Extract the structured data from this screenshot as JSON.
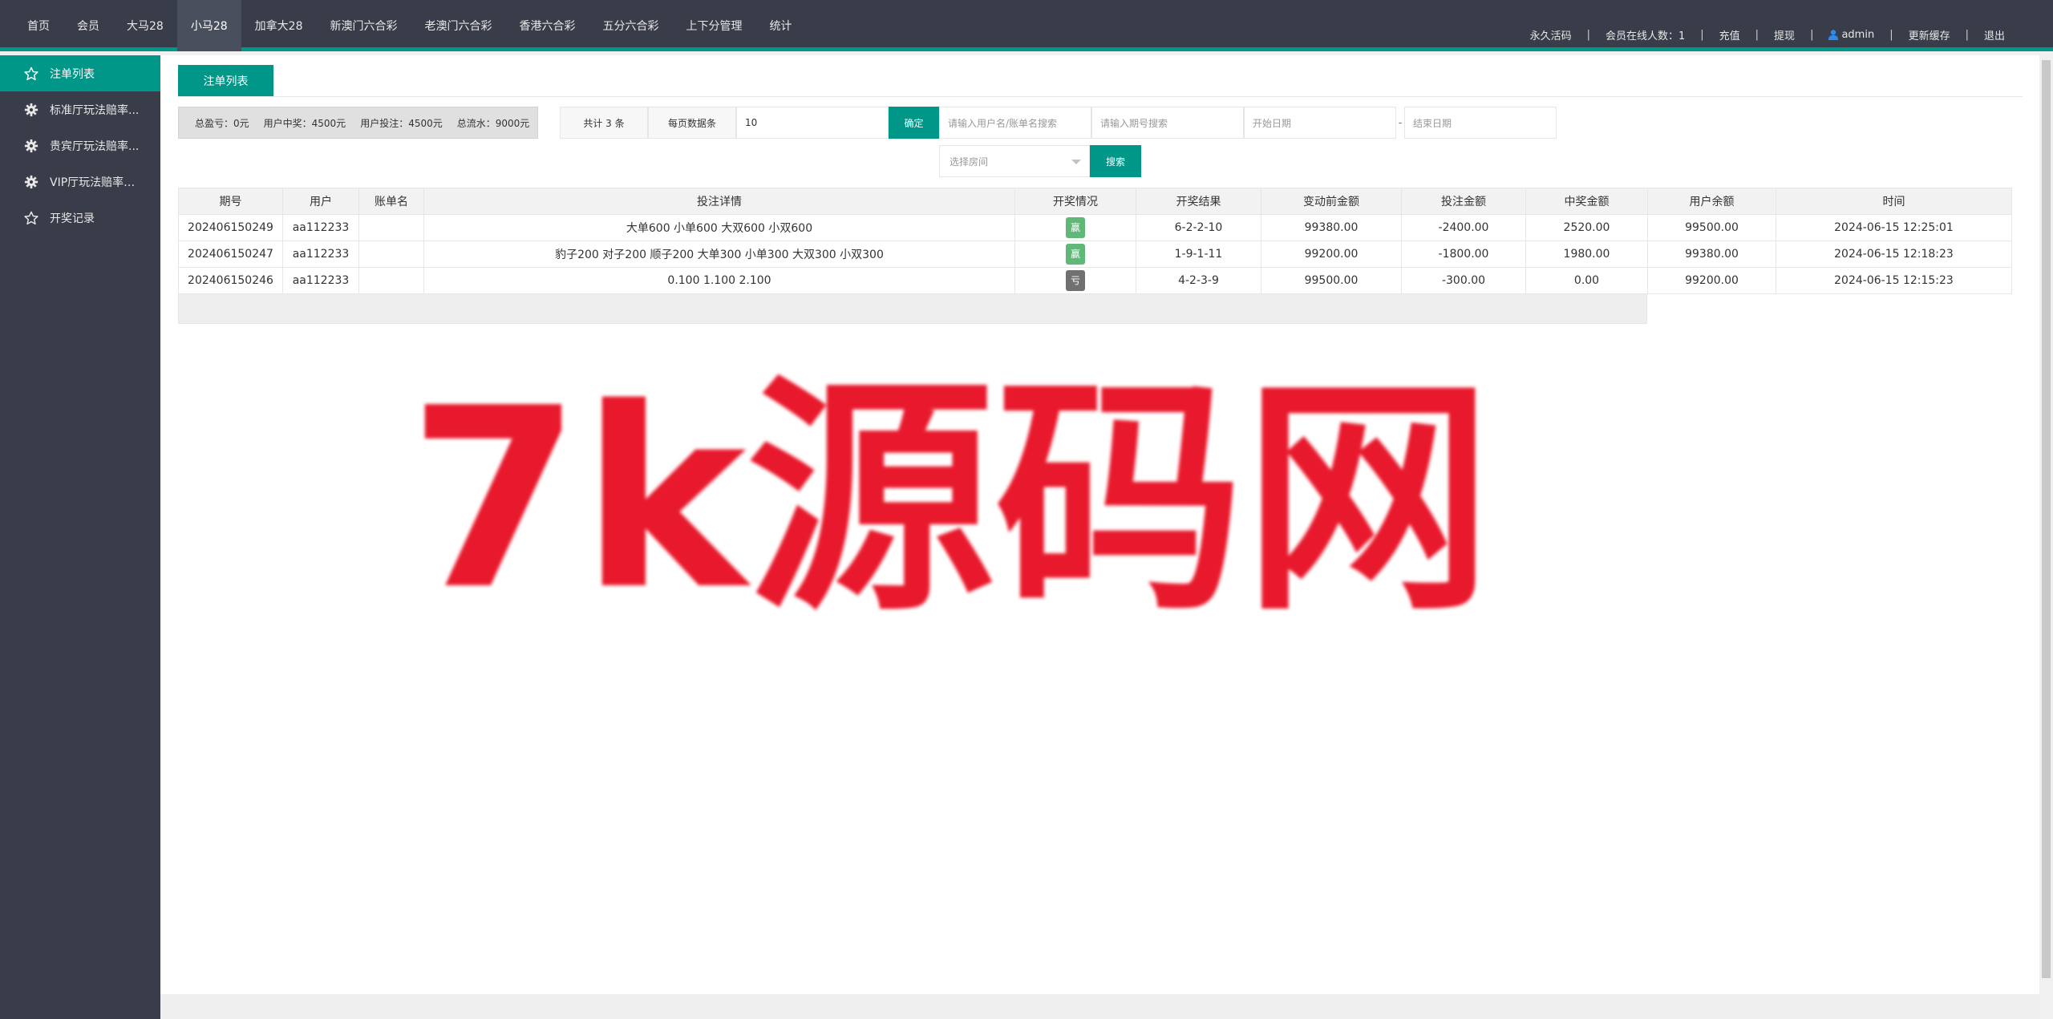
{
  "topnav": {
    "items": [
      {
        "label": "首页"
      },
      {
        "label": "会员"
      },
      {
        "label": "大马28"
      },
      {
        "label": "小马28",
        "active": true
      },
      {
        "label": "加拿大28"
      },
      {
        "label": "新澳门六合彩"
      },
      {
        "label": "老澳门六合彩"
      },
      {
        "label": "香港六合彩"
      },
      {
        "label": "五分六合彩"
      },
      {
        "label": "上下分管理"
      },
      {
        "label": "统计"
      }
    ]
  },
  "topright": {
    "permanent_code": "永久活码",
    "online_members": "会员在线人数：1",
    "recharge": "充值",
    "withdraw": "提现",
    "user": "admin",
    "refresh_cache": "更新缓存",
    "logout": "退出",
    "separator": "|"
  },
  "sidebar": {
    "items": [
      {
        "label": "注单列表",
        "icon": "star-icon",
        "active": true
      },
      {
        "label": "标准厅玩法赔率...",
        "icon": "gear-icon"
      },
      {
        "label": "贵宾厅玩法赔率...",
        "icon": "gear-icon"
      },
      {
        "label": "VIP厅玩法赔率设...",
        "icon": "gear-icon"
      },
      {
        "label": "开奖记录",
        "icon": "star-icon"
      }
    ]
  },
  "tab": {
    "label": "注单列表"
  },
  "summary": {
    "total_profit": "总盈亏：0元",
    "user_win": "用户中奖：4500元",
    "user_bet": "用户投注：4500元",
    "total_flow": "总流水：9000元"
  },
  "filters": {
    "total_count": "共计 3 条",
    "per_page_label": "每页数据条",
    "per_page_value": "10",
    "confirm": "确定",
    "user_placeholder": "请输入用户名/账单名搜索",
    "period_placeholder": "请输入期号搜索",
    "start_date_placeholder": "开始日期",
    "dash": "-",
    "end_date_placeholder": "结束日期",
    "room_placeholder": "选择房间",
    "search": "搜索"
  },
  "table": {
    "headers": [
      "期号",
      "用户",
      "账单名",
      "投注详情",
      "开奖情况",
      "开奖结果",
      "变动前金额",
      "投注金额",
      "中奖金额",
      "用户余额",
      "时间"
    ],
    "rows": [
      {
        "period": "202406150249",
        "user": "aa112233",
        "bill": "",
        "detail": "大单600 小单600 大双600 小双600",
        "status": "赢",
        "status_type": "win",
        "result": "6-2-2-10",
        "before": "99380.00",
        "bet": "-2400.00",
        "win": "2520.00",
        "balance": "99500.00",
        "time": "2024-06-15 12:25:01"
      },
      {
        "period": "202406150247",
        "user": "aa112233",
        "bill": "",
        "detail": "豹子200 对子200 顺子200 大单300 小单300 大双300 小双300",
        "status": "赢",
        "status_type": "win",
        "result": "1-9-1-11",
        "before": "99200.00",
        "bet": "-1800.00",
        "win": "1980.00",
        "balance": "99380.00",
        "time": "2024-06-15 12:18:23"
      },
      {
        "period": "202406150246",
        "user": "aa112233",
        "bill": "",
        "detail": "0.100 1.100 2.100",
        "status": "亏",
        "status_type": "lose",
        "result": "4-2-3-9",
        "before": "99500.00",
        "bet": "-300.00",
        "win": "0.00",
        "balance": "99200.00",
        "time": "2024-06-15 12:15:23"
      }
    ]
  },
  "watermark": {
    "text": "7k源码网"
  },
  "colors": {
    "nav_bg": "#393D49",
    "accent": "#009688",
    "win": "#5FB878",
    "lose": "#707070",
    "watermark": "#e8192c"
  }
}
